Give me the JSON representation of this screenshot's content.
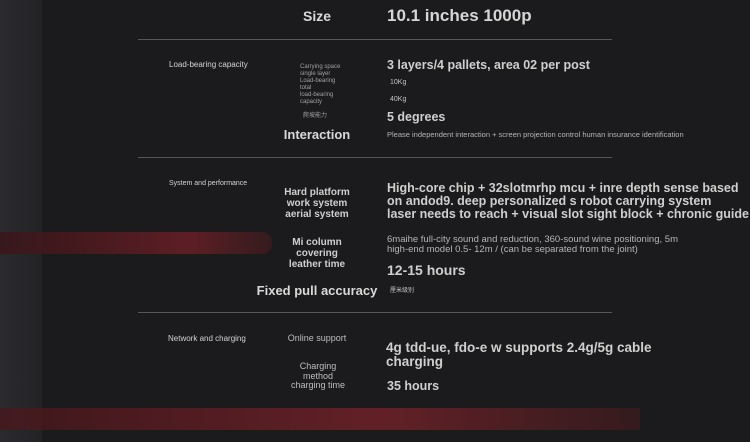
{
  "sections": {
    "load": "Load-bearing capacity",
    "system": "System and performance",
    "network": "Network and charging"
  },
  "rows": {
    "size_label": "Size",
    "size_value": "10.1 inches 1000p",
    "load_small_labels": [
      "Carrying space",
      "single layer",
      "Load-bearing",
      "total",
      "load-bearing",
      "capacity"
    ],
    "load_value": "3 layers/4 pallets, area 02 per post",
    "load_10kg": "10Kg",
    "load_40kg": "40Kg",
    "climb_label": "爬坡能力",
    "climb_value": "5 degrees",
    "interaction_label": "Interaction",
    "interaction_value": "Please independent interaction + screen projection control human insurance identification",
    "hard_label": [
      "Hard platform",
      "work system",
      "aerial system"
    ],
    "hard_value": [
      "High-core chip + 32slotmrhp mcu + inre depth sense based",
      "on andod9. deep personalized s robot carrying system",
      "laser needs to reach + visual slot sight block + chronic guide"
    ],
    "mic_label": [
      "Mi column",
      "covering",
      "leather time"
    ],
    "mic_value": [
      "6maihe full-city sound and reduction, 360-sound wine positioning, 5m",
      "high-end model 0.5- 12m / (can be separated from the joint)"
    ],
    "time_value": "12-15 hours",
    "pull_label": "Fixed pull accuracy",
    "pull_value": "厘米级别",
    "online_label": "Online support",
    "online_value": [
      "4g tdd-ue, fdo-e w supports 2.4g/5g cable",
      "charging"
    ],
    "charge_label": [
      "Charging",
      "method",
      "charging time"
    ],
    "charge_value": "35 hours"
  }
}
